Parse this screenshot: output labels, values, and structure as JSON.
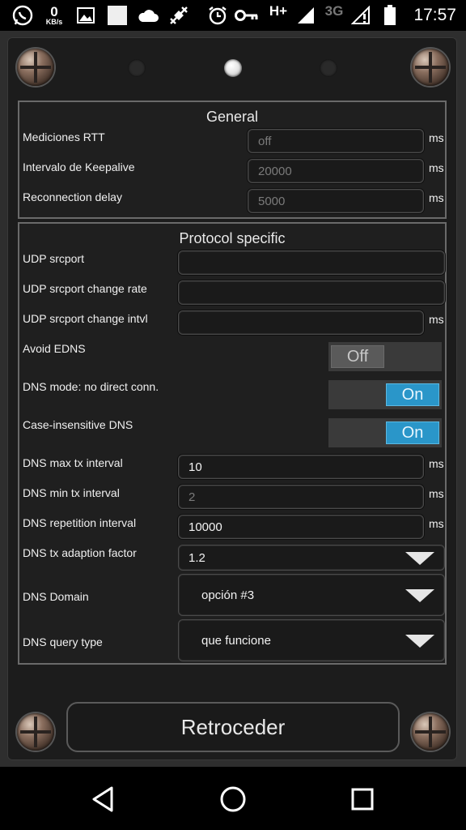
{
  "status_bar": {
    "time": "17:57",
    "speed_value": "0",
    "speed_unit": "KB/s",
    "network_type_h": "H+",
    "network_type_3g": "3G",
    "icons": [
      "whatsapp-icon",
      "image-icon",
      "placeholder-square-icon",
      "cloud-icon",
      "satellite-icon",
      "alarm-icon",
      "key-icon",
      "signal-icon",
      "signal-alert-icon",
      "battery-icon"
    ]
  },
  "pager": {
    "pages": 3,
    "active_index": 1
  },
  "general": {
    "title": "General",
    "rows": [
      {
        "label": "Mediciones RTT",
        "value": "off",
        "unit": "ms"
      },
      {
        "label": "Intervalo de Keepalive",
        "value": "20000",
        "unit": "ms"
      },
      {
        "label": "Reconnection delay",
        "value": "5000",
        "unit": "ms"
      }
    ]
  },
  "protocol": {
    "title": "Protocol specific",
    "udp_srcport": {
      "label": "UDP srcport",
      "value": ""
    },
    "udp_rate": {
      "label": "UDP srcport change rate",
      "value": ""
    },
    "udp_intvl": {
      "label": "UDP srcport change intvl",
      "value": "",
      "unit": "ms"
    },
    "avoid_edns": {
      "label": "Avoid EDNS",
      "state": "Off"
    },
    "dns_mode": {
      "label": "DNS mode: no direct conn.",
      "state": "On"
    },
    "case_dns": {
      "label": "Case-insensitive DNS",
      "state": "On"
    },
    "dns_max": {
      "label": "DNS max tx interval",
      "value": "10",
      "unit": "ms"
    },
    "dns_min": {
      "label": "DNS min tx interval",
      "value": "2",
      "unit": "ms"
    },
    "dns_rep": {
      "label": "DNS repetition interval",
      "value": "10000",
      "unit": "ms"
    },
    "dns_factor": {
      "label": "DNS tx adaption factor",
      "value": "1.2"
    },
    "dns_domain": {
      "label": "DNS Domain",
      "value": "opción #3"
    },
    "dns_query": {
      "label": "DNS query type",
      "value": "que funcione"
    }
  },
  "back_button": "Retroceder",
  "colors": {
    "toggle_on": "#2a96c9",
    "toggle_off": "#5a5a5a",
    "background": "#1c1c1c"
  }
}
